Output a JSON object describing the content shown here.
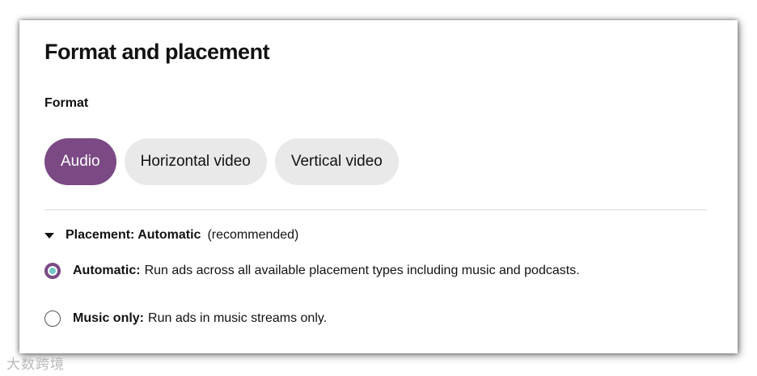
{
  "panel": {
    "title": "Format and placement"
  },
  "format": {
    "label": "Format",
    "options": [
      {
        "label": "Audio",
        "selected": true
      },
      {
        "label": "Horizontal video",
        "selected": false
      },
      {
        "label": "Vertical video",
        "selected": false
      }
    ]
  },
  "placement": {
    "toggle_label": "Placement: Automatic",
    "toggle_note": "(recommended)",
    "expanded": true,
    "options": [
      {
        "title": "Automatic:",
        "description": "Run ads across all available placement types including music and podcasts.",
        "checked": true
      },
      {
        "title": "Music only:",
        "description": "Run ads in music streams only.",
        "checked": false
      }
    ]
  },
  "colors": {
    "accent": "#7b4a85",
    "radio_inner": "#70c7c7",
    "chip_bg": "#e9e9e9"
  },
  "watermark": "大数跨境"
}
